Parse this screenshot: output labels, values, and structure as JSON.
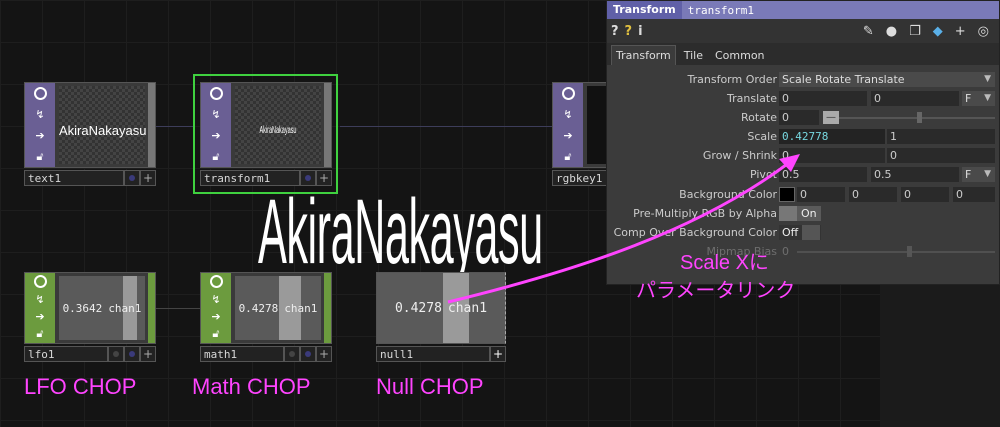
{
  "canvas": {
    "big_text": "AkiraNakayasu",
    "nodes": {
      "text1": {
        "name": "text1",
        "preview_text": "AkiraNakayasu"
      },
      "transform1": {
        "name": "transform1",
        "preview_text": "AkiraNakayasu"
      },
      "rgbkey1": {
        "name": "rgbkey1"
      },
      "lfo1": {
        "name": "lfo1",
        "value": "0.3642",
        "channel": "chan1"
      },
      "math1": {
        "name": "math1",
        "value": "0.4278",
        "channel": "chan1"
      },
      "null1": {
        "name": "null1",
        "value": "0.4278",
        "channel": "chan1"
      }
    }
  },
  "annotations": {
    "lfo_label": "LFO CHOP",
    "math_label": "Math CHOP",
    "null_label": "Null CHOP",
    "link_label_line1": "Scale Xに",
    "link_label_line2": "パラメータリンク",
    "accent_color": "#ff44ff"
  },
  "panel": {
    "op_type": "Transform",
    "op_name": "transform1",
    "toolbar_left": [
      "help-icon",
      "python-help-icon",
      "info-icon"
    ],
    "toolbar_right": [
      "edit-icon",
      "comment-icon",
      "copy-icon",
      "python-icon",
      "add-icon",
      "target-icon"
    ],
    "tabs": [
      "Transform",
      "Tile",
      "Common"
    ],
    "active_tab": "Transform",
    "params": {
      "transform_order": {
        "label": "Transform Order",
        "value": "Scale Rotate Translate"
      },
      "translate": {
        "label": "Translate",
        "x": "0",
        "y": "0",
        "unit": "F"
      },
      "rotate": {
        "label": "Rotate",
        "value": "0"
      },
      "scale": {
        "label": "Scale",
        "x": "0.42778",
        "y": "1"
      },
      "grow_shrink": {
        "label": "Grow / Shrink",
        "x": "0",
        "y": "0"
      },
      "pivot": {
        "label": "Pivot",
        "x": "0.5",
        "y": "0.5",
        "unit": "F"
      },
      "background_color": {
        "label": "Background Color",
        "r": "0",
        "g": "0",
        "b": "0",
        "a": "0"
      },
      "premultiply": {
        "label": "Pre-Multiply RGB by Alpha",
        "value": "On"
      },
      "comp_over": {
        "label": "Comp Over Background Color",
        "value": "Off"
      },
      "mipmap": {
        "label": "Mipmap Bias",
        "value": "0"
      }
    }
  }
}
